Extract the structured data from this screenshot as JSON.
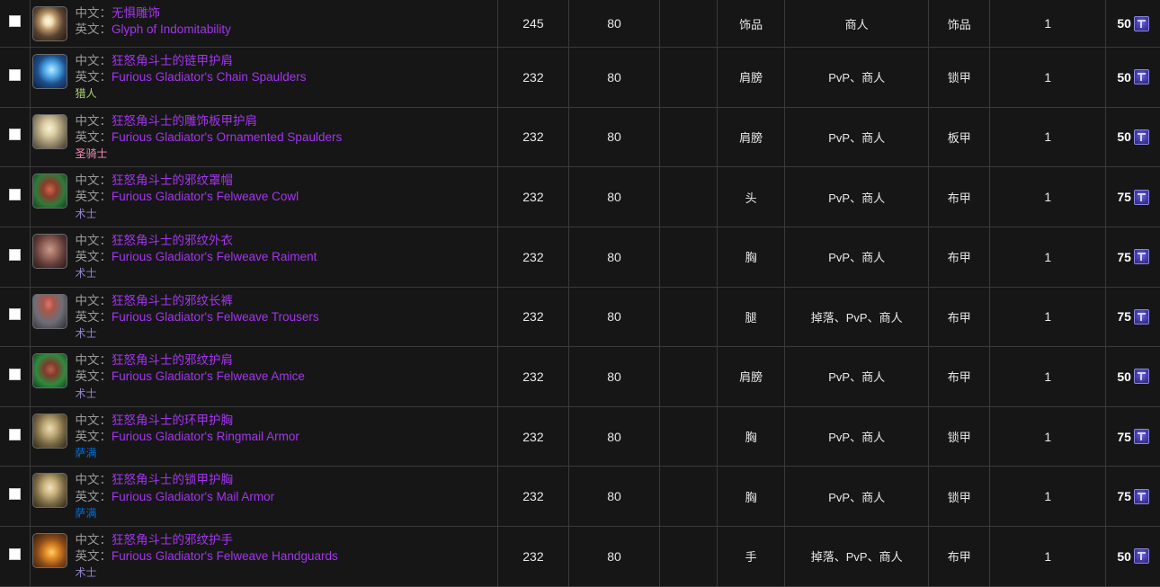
{
  "table": {
    "labels": {
      "zh_prefix": "中文：",
      "en_prefix": "英文："
    },
    "class_colors": {
      "hunter": "#abd473",
      "paladin": "#f58cba",
      "warlock": "#9482c9",
      "shaman": "#0070de"
    },
    "item_quality_color": "#a335ee",
    "currency_icon": "emblem-of-triumph-icon",
    "rows": [
      {
        "checkbox": false,
        "icon": "glyph-of-indomitability-icon",
        "name_zh": "无惧雕饰",
        "name_en": "Glyph of Indomitability",
        "class": "",
        "class_key": "",
        "ilvl": "245",
        "req_level": "80",
        "blank": "",
        "slot": "饰品",
        "source": "商人",
        "armor": "饰品",
        "count": "1",
        "cost": "50"
      },
      {
        "checkbox": false,
        "icon": "furious-gladiators-chain-spaulders-icon",
        "name_zh": "狂怒角斗士的链甲护肩",
        "name_en": "Furious Gladiator's Chain Spaulders",
        "class": "猎人",
        "class_key": "hunter",
        "ilvl": "232",
        "req_level": "80",
        "blank": "",
        "slot": "肩膀",
        "source": "PvP、商人",
        "armor": "锁甲",
        "count": "1",
        "cost": "50"
      },
      {
        "checkbox": false,
        "icon": "furious-gladiators-ornamented-spaulders-icon",
        "name_zh": "狂怒角斗士的雕饰板甲护肩",
        "name_en": "Furious Gladiator's Ornamented Spaulders",
        "class": "圣骑士",
        "class_key": "paladin",
        "ilvl": "232",
        "req_level": "80",
        "blank": "",
        "slot": "肩膀",
        "source": "PvP、商人",
        "armor": "板甲",
        "count": "1",
        "cost": "50"
      },
      {
        "checkbox": false,
        "icon": "furious-gladiators-felweave-cowl-icon",
        "name_zh": "狂怒角斗士的邪纹罩帽",
        "name_en": "Furious Gladiator's Felweave Cowl",
        "class": "术士",
        "class_key": "warlock",
        "ilvl": "232",
        "req_level": "80",
        "blank": "",
        "slot": "头",
        "source": "PvP、商人",
        "armor": "布甲",
        "count": "1",
        "cost": "75"
      },
      {
        "checkbox": false,
        "icon": "furious-gladiators-felweave-raiment-icon",
        "name_zh": "狂怒角斗士的邪纹外衣",
        "name_en": "Furious Gladiator's Felweave Raiment",
        "class": "术士",
        "class_key": "warlock",
        "ilvl": "232",
        "req_level": "80",
        "blank": "",
        "slot": "胸",
        "source": "PvP、商人",
        "armor": "布甲",
        "count": "1",
        "cost": "75"
      },
      {
        "checkbox": false,
        "icon": "furious-gladiators-felweave-trousers-icon",
        "name_zh": "狂怒角斗士的邪纹长裤",
        "name_en": "Furious Gladiator's Felweave Trousers",
        "class": "术士",
        "class_key": "warlock",
        "ilvl": "232",
        "req_level": "80",
        "blank": "",
        "slot": "腿",
        "source": "掉落、PvP、商人",
        "armor": "布甲",
        "count": "1",
        "cost": "75"
      },
      {
        "checkbox": false,
        "icon": "furious-gladiators-felweave-amice-icon",
        "name_zh": "狂怒角斗士的邪纹护肩",
        "name_en": "Furious Gladiator's Felweave Amice",
        "class": "术士",
        "class_key": "warlock",
        "ilvl": "232",
        "req_level": "80",
        "blank": "",
        "slot": "肩膀",
        "source": "PvP、商人",
        "armor": "布甲",
        "count": "1",
        "cost": "50"
      },
      {
        "checkbox": false,
        "icon": "furious-gladiators-ringmail-armor-icon",
        "name_zh": "狂怒角斗士的环甲护胸",
        "name_en": "Furious Gladiator's Ringmail Armor",
        "class": "萨满",
        "class_key": "shaman",
        "ilvl": "232",
        "req_level": "80",
        "blank": "",
        "slot": "胸",
        "source": "PvP、商人",
        "armor": "锁甲",
        "count": "1",
        "cost": "75"
      },
      {
        "checkbox": false,
        "icon": "furious-gladiators-mail-armor-icon",
        "name_zh": "狂怒角斗士的锁甲护胸",
        "name_en": "Furious Gladiator's Mail Armor",
        "class": "萨满",
        "class_key": "shaman",
        "ilvl": "232",
        "req_level": "80",
        "blank": "",
        "slot": "胸",
        "source": "PvP、商人",
        "armor": "锁甲",
        "count": "1",
        "cost": "75"
      },
      {
        "checkbox": false,
        "icon": "furious-gladiators-felweave-handguards-icon",
        "name_zh": "狂怒角斗士的邪纹护手",
        "name_en": "Furious Gladiator's Felweave Handguards",
        "class": "术士",
        "class_key": "warlock",
        "ilvl": "232",
        "req_level": "80",
        "blank": "",
        "slot": "手",
        "source": "掉落、PvP、商人",
        "armor": "布甲",
        "count": "1",
        "cost": "50"
      }
    ]
  }
}
